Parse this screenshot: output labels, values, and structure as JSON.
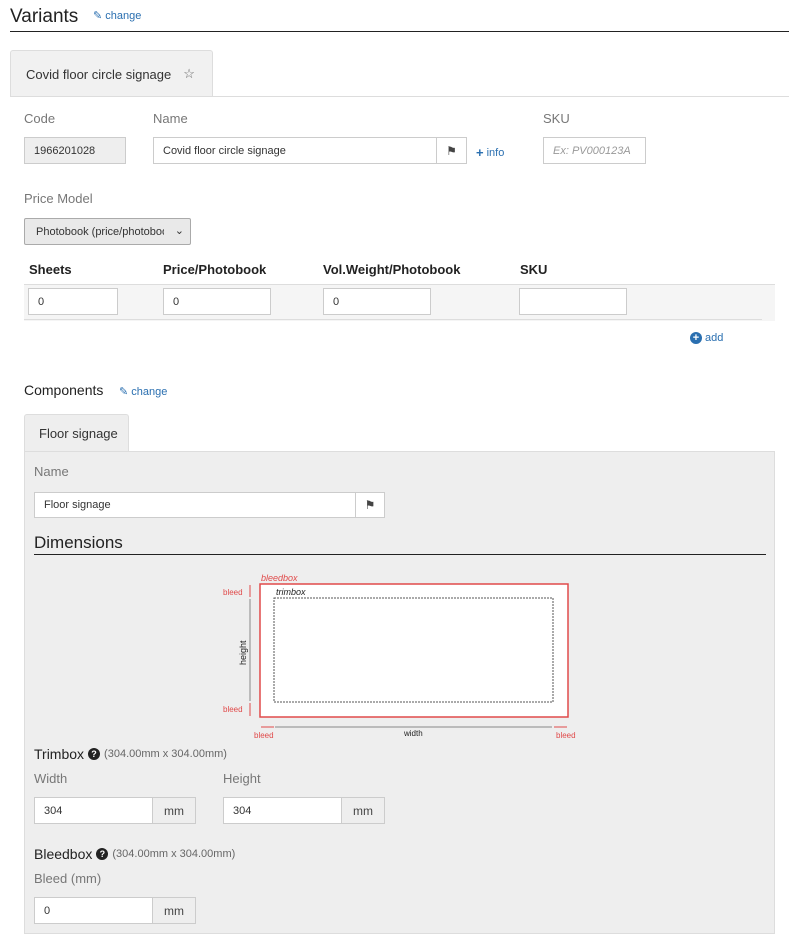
{
  "header": {
    "title": "Variants",
    "change_label": "change"
  },
  "variant_tab": {
    "label": "Covid floor circle signage"
  },
  "fields": {
    "code_label": "Code",
    "code_value": "1966201028",
    "name_label": "Name",
    "name_value": "Covid floor circle signage",
    "info_label": "info",
    "sku_label": "SKU",
    "sku_placeholder": "Ex: PV000123A",
    "price_model_label": "Price Model",
    "price_model_value": "Photobook (price/photobook)"
  },
  "price_table": {
    "headers": [
      "Sheets",
      "Price/Photobook",
      "Vol.Weight/Photobook",
      "SKU"
    ],
    "row": [
      "0",
      "0",
      "0",
      ""
    ],
    "add_label": "add"
  },
  "components": {
    "title": "Components",
    "change_label": "change",
    "tab_label": "Floor signage",
    "name_label": "Name",
    "name_value": "Floor signage",
    "dimensions_title": "Dimensions",
    "diagram": {
      "bleedbox": "bleedbox",
      "trimbox": "trimbox",
      "bleed": "bleed",
      "height": "height",
      "width": "width"
    },
    "trimbox": {
      "title": "Trimbox",
      "note": "(304.00mm x 304.00mm)",
      "width_label": "Width",
      "width_value": "304",
      "height_label": "Height",
      "height_value": "304",
      "unit": "mm"
    },
    "bleedbox": {
      "title": "Bleedbox",
      "note": "(304.00mm x 304.00mm)",
      "bleed_label": "Bleed (mm)",
      "bleed_value": "0",
      "unit": "mm"
    }
  },
  "colors": {
    "link": "#2a6fb0",
    "bleed": "#e04a4a"
  }
}
